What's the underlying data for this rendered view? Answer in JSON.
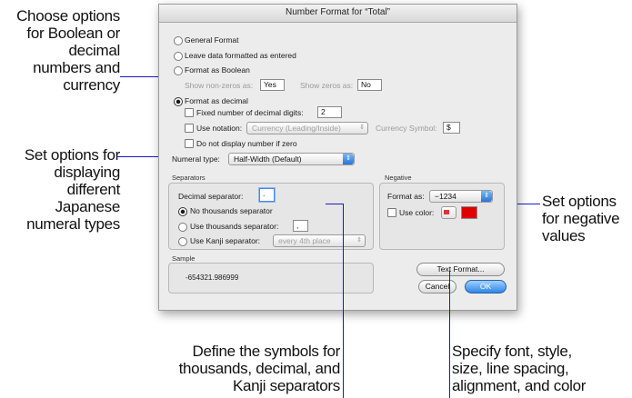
{
  "callouts": {
    "boolean": [
      "Choose options",
      "for Boolean or",
      "decimal",
      "numbers and",
      "currency"
    ],
    "numeral": [
      "Set options for",
      "displaying",
      "different",
      "Japanese",
      "numeral types"
    ],
    "negative": [
      "Set options",
      "for negative",
      "values"
    ],
    "separators": [
      "Define the symbols for",
      "thousands, decimal, and",
      "Kanji separators"
    ],
    "textformat": [
      "Specify font, style,",
      "size, line spacing,",
      "alignment, and color"
    ]
  },
  "dialog": {
    "title": "Number Format for “Total”",
    "general": "General Format",
    "leave": "Leave data formatted as entered",
    "boolean": "Format as Boolean",
    "nonzero_label": "Show non-zeros as:",
    "nonzero_value": "Yes",
    "zero_label": "Show zeros as:",
    "zero_value": "No",
    "decimal": "Format as decimal",
    "fixed": "Fixed number of decimal digits:",
    "fixed_value": "2",
    "notation": "Use notation:",
    "notation_value": "Currency (Leading/Inside)",
    "currency_label": "Currency Symbol:",
    "currency_value": "$",
    "no_display_zero": "Do not display number if zero",
    "numeral_label": "Numeral type:",
    "numeral_value": "Half-Width (Default)",
    "separators_title": "Separators",
    "decimal_sep_label": "Decimal separator:",
    "decimal_sep_value": ".",
    "no_thousands": "No thousands separator",
    "use_thousands": "Use thousands separator:",
    "thousands_value": ",",
    "kanji": "Use Kanji separator:",
    "kanji_value": "every 4th place",
    "negative_title": "Negative",
    "format_as_label": "Format as:",
    "format_as_value": "−1234",
    "use_color": "Use color:",
    "sample_title": "Sample",
    "sample_value": "-654321.986999",
    "text_format": "Text Format...",
    "cancel": "Cancel",
    "ok": "OK"
  },
  "colors": {
    "accent_bar": "#0b00ff",
    "negative_color": "#e00000",
    "default_button": "#2f86e6"
  }
}
